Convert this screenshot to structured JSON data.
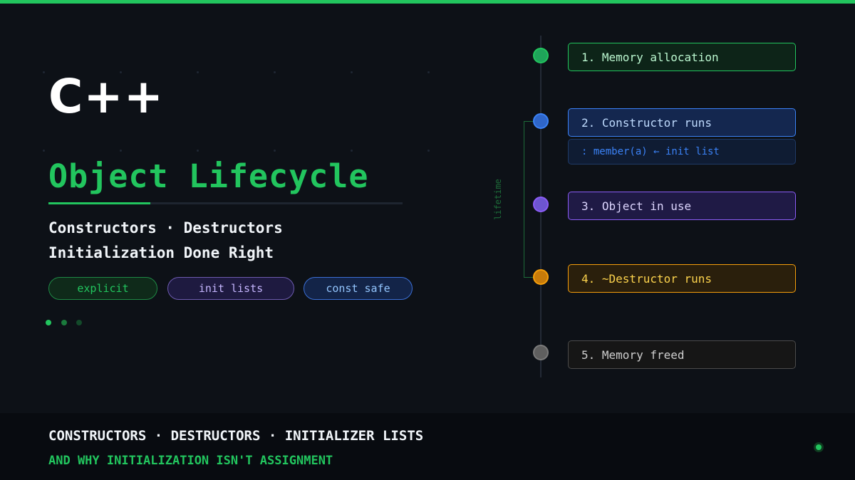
{
  "colors": {
    "background": "#0d1117",
    "accent_green": "#22c55e",
    "accent_blue": "#3b82f6",
    "accent_purple": "#8b5cf6",
    "accent_amber": "#f59e0b",
    "muted_gray": "#7a7a7a"
  },
  "hero": {
    "logo": "C++",
    "title": "Object Lifecycle",
    "subtitle_line1": "Constructors · Destructors",
    "subtitle_line2": "Initialization Done Right",
    "tags": [
      "explicit",
      "init lists",
      "const safe"
    ]
  },
  "timeline": {
    "bracket_label": "lifetime",
    "steps": [
      {
        "label": "1. Memory allocation",
        "color": "#22c55e"
      },
      {
        "label": "2. Constructor runs",
        "color": "#3b82f6",
        "note": ": member(a) ← init list"
      },
      {
        "label": "3. Object in use",
        "color": "#8b5cf6"
      },
      {
        "label": "4. ~Destructor runs",
        "color": "#f59e0b"
      },
      {
        "label": "5. Memory freed",
        "color": "#7a7a7a"
      }
    ]
  },
  "footer": {
    "line1": "CONSTRUCTORS · DESTRUCTORS · INITIALIZER LISTS",
    "line2": "AND WHY INITIALIZATION ISN'T ASSIGNMENT"
  }
}
